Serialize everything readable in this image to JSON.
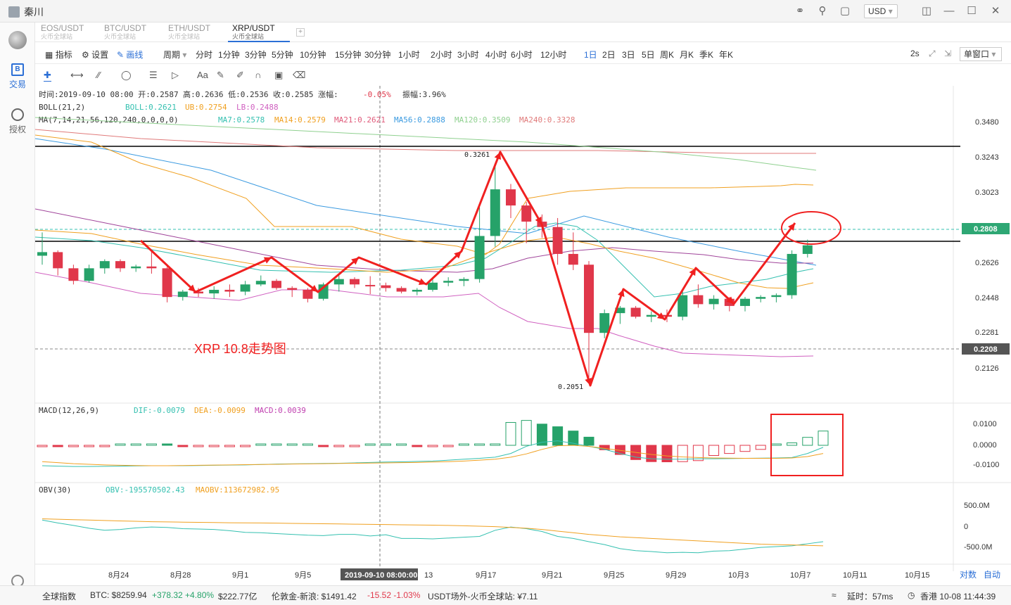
{
  "window": {
    "user": "秦川",
    "currency": "USD",
    "currency_arrow": "▾"
  },
  "sidebar": {
    "trade_label": "交易",
    "auth_label": "授权"
  },
  "tabs": [
    {
      "pair": "EOS/USDT",
      "exchange": "火币全球站"
    },
    {
      "pair": "BTC/USDT",
      "exchange": "火币全球站"
    },
    {
      "pair": "ETH/USDT",
      "exchange": "火币全球站"
    },
    {
      "pair": "XRP/USDT",
      "exchange": "火币全球站"
    }
  ],
  "toolbar": {
    "indicator": "指标",
    "settings": "设置",
    "draw": "画线",
    "period": "周期",
    "intervals": [
      "分时",
      "1分钟",
      "3分钟",
      "5分钟",
      "10分钟",
      "15分钟",
      "30分钟",
      "1小时",
      "2小时",
      "3小时",
      "4小时",
      "6小时",
      "12小时",
      "1日",
      "2日",
      "3日",
      "5日",
      "周K",
      "月K",
      "季K",
      "年K"
    ],
    "active_interval": "1日",
    "refresh": "2s",
    "window_mode": "单窗口"
  },
  "info": {
    "time_label": "时间:",
    "time": "2019-09-10 08:00",
    "open_label": "开:",
    "open": "0.2587",
    "high_label": "高:",
    "high": "0.2636",
    "low_label": "低:",
    "low": "0.2536",
    "close_label": "收:",
    "close": "0.2585",
    "change_label": "涨幅:",
    "change": "-0.05%",
    "amp_label": "振幅:",
    "amp": "3.96%"
  },
  "boll": {
    "name": "BOLL(21,2)",
    "mid": "BOLL:0.2621",
    "ub": "UB:0.2754",
    "lb": "LB:0.2488"
  },
  "ma": {
    "name": "MA(7,14,21,56,120,240,0,0,0,0)",
    "ma7": "MA7:0.2578",
    "ma14": "MA14:0.2579",
    "ma21": "MA21:0.2621",
    "ma56": "MA56:0.2888",
    "ma120": "MA120:0.3509",
    "ma240": "MA240:0.3328"
  },
  "macd": {
    "name": "MACD(12,26,9)",
    "dif": "DIF:-0.0079",
    "dea": "DEA:-0.0099",
    "macd": "MACD:0.0039"
  },
  "obv": {
    "name": "OBV(30)",
    "obv": "OBV:-195570502.43",
    "maobv": "MAOBV:113672982.95"
  },
  "annotation": "XRP 10.8走势图",
  "price_axis": [
    "0.3480",
    "0.3243",
    "0.3023",
    "0.2808",
    "0.2626",
    "0.2448",
    "0.2281",
    "0.2208",
    "0.2126"
  ],
  "macd_axis": [
    "0.0100",
    "0.0000",
    "-0.0100"
  ],
  "obv_axis": [
    "500.0M",
    "0",
    "-500.0M"
  ],
  "date_axis": [
    "8月24",
    "8月28",
    "9月1",
    "9月5",
    "13",
    "9月17",
    "9月21",
    "9月25",
    "9月29",
    "10月3",
    "10月7",
    "10月11",
    "10月15"
  ],
  "crosshair_date": "2019-09-10 08:00:00",
  "hi_label": "0.3261",
  "lo_label": "0.2051",
  "axis_buttons": {
    "log": "对数",
    "auto": "自动"
  },
  "status": {
    "index": "全球指数",
    "btc": "BTC: $8259.94",
    "btc_chg": "+378.32 +4.80%",
    "btc_cap": "$222.77亿",
    "gold": "伦敦金-新浪: $1491.42",
    "gold_chg": "-15.52 -1.03%",
    "usdt": "USDT场外-火币全球站: ¥7.11",
    "latency": "延时：57ms",
    "time": "香港 10-08 11:44:39"
  },
  "colors": {
    "up": "#26a269",
    "down": "#e0374a",
    "boll_mid": "#a0449a",
    "ub_lb": "#d060c0",
    "ma7": "#34c0b0",
    "ma14": "#f0a020",
    "accent": "#2b6fd6"
  },
  "chart_data": {
    "type": "candlestick",
    "price_range": [
      0.2051,
      0.3261
    ],
    "candles": [
      {
        "o": 0.275,
        "h": 0.288,
        "l": 0.27,
        "c": 0.277
      },
      {
        "o": 0.277,
        "h": 0.278,
        "l": 0.264,
        "c": 0.268
      },
      {
        "o": 0.268,
        "h": 0.27,
        "l": 0.259,
        "c": 0.261
      },
      {
        "o": 0.261,
        "h": 0.27,
        "l": 0.26,
        "c": 0.268
      },
      {
        "o": 0.268,
        "h": 0.273,
        "l": 0.265,
        "c": 0.272
      },
      {
        "o": 0.272,
        "h": 0.273,
        "l": 0.266,
        "c": 0.268
      },
      {
        "o": 0.268,
        "h": 0.27,
        "l": 0.266,
        "c": 0.269
      },
      {
        "o": 0.269,
        "h": 0.278,
        "l": 0.265,
        "c": 0.268
      },
      {
        "o": 0.268,
        "h": 0.269,
        "l": 0.249,
        "c": 0.252
      },
      {
        "o": 0.252,
        "h": 0.256,
        "l": 0.25,
        "c": 0.255
      },
      {
        "o": 0.255,
        "h": 0.257,
        "l": 0.252,
        "c": 0.254
      },
      {
        "o": 0.254,
        "h": 0.258,
        "l": 0.251,
        "c": 0.256
      },
      {
        "o": 0.256,
        "h": 0.259,
        "l": 0.252,
        "c": 0.255
      },
      {
        "o": 0.255,
        "h": 0.261,
        "l": 0.253,
        "c": 0.259
      },
      {
        "o": 0.259,
        "h": 0.264,
        "l": 0.258,
        "c": 0.261
      },
      {
        "o": 0.261,
        "h": 0.262,
        "l": 0.256,
        "c": 0.257
      },
      {
        "o": 0.257,
        "h": 0.258,
        "l": 0.252,
        "c": 0.256
      },
      {
        "o": 0.256,
        "h": 0.257,
        "l": 0.249,
        "c": 0.251
      },
      {
        "o": 0.251,
        "h": 0.26,
        "l": 0.25,
        "c": 0.259
      },
      {
        "o": 0.259,
        "h": 0.264,
        "l": 0.255,
        "c": 0.262
      },
      {
        "o": 0.262,
        "h": 0.263,
        "l": 0.257,
        "c": 0.259
      },
      {
        "o": 0.2587,
        "h": 0.2636,
        "l": 0.2536,
        "c": 0.2585
      },
      {
        "o": 0.2585,
        "h": 0.26,
        "l": 0.255,
        "c": 0.257
      },
      {
        "o": 0.257,
        "h": 0.258,
        "l": 0.254,
        "c": 0.255
      },
      {
        "o": 0.255,
        "h": 0.257,
        "l": 0.253,
        "c": 0.256
      },
      {
        "o": 0.256,
        "h": 0.262,
        "l": 0.255,
        "c": 0.26
      },
      {
        "o": 0.26,
        "h": 0.263,
        "l": 0.258,
        "c": 0.261
      },
      {
        "o": 0.261,
        "h": 0.263,
        "l": 0.258,
        "c": 0.262
      },
      {
        "o": 0.262,
        "h": 0.302,
        "l": 0.26,
        "c": 0.286
      },
      {
        "o": 0.286,
        "h": 0.3261,
        "l": 0.28,
        "c": 0.312
      },
      {
        "o": 0.312,
        "h": 0.315,
        "l": 0.296,
        "c": 0.303
      },
      {
        "o": 0.303,
        "h": 0.305,
        "l": 0.282,
        "c": 0.294
      },
      {
        "o": 0.294,
        "h": 0.298,
        "l": 0.285,
        "c": 0.291
      },
      {
        "o": 0.291,
        "h": 0.296,
        "l": 0.27,
        "c": 0.276
      },
      {
        "o": 0.276,
        "h": 0.288,
        "l": 0.267,
        "c": 0.27
      },
      {
        "o": 0.27,
        "h": 0.272,
        "l": 0.2051,
        "c": 0.232
      },
      {
        "o": 0.232,
        "h": 0.245,
        "l": 0.229,
        "c": 0.243
      },
      {
        "o": 0.243,
        "h": 0.247,
        "l": 0.237,
        "c": 0.246
      },
      {
        "o": 0.246,
        "h": 0.247,
        "l": 0.24,
        "c": 0.241
      },
      {
        "o": 0.241,
        "h": 0.244,
        "l": 0.238,
        "c": 0.242
      },
      {
        "o": 0.242,
        "h": 0.245,
        "l": 0.238,
        "c": 0.241
      },
      {
        "o": 0.241,
        "h": 0.256,
        "l": 0.239,
        "c": 0.253
      },
      {
        "o": 0.253,
        "h": 0.259,
        "l": 0.246,
        "c": 0.248
      },
      {
        "o": 0.248,
        "h": 0.253,
        "l": 0.245,
        "c": 0.251
      },
      {
        "o": 0.251,
        "h": 0.252,
        "l": 0.244,
        "c": 0.247
      },
      {
        "o": 0.247,
        "h": 0.252,
        "l": 0.244,
        "c": 0.251
      },
      {
        "o": 0.251,
        "h": 0.253,
        "l": 0.249,
        "c": 0.252
      },
      {
        "o": 0.252,
        "h": 0.254,
        "l": 0.249,
        "c": 0.253
      },
      {
        "o": 0.253,
        "h": 0.278,
        "l": 0.251,
        "c": 0.276
      },
      {
        "o": 0.276,
        "h": 0.284,
        "l": 0.274,
        "c": 0.2808
      }
    ],
    "macd_hist": [
      -0.0003,
      -0.0004,
      -0.0003,
      -0.0002,
      -0.0001,
      0.0001,
      0.0001,
      0.0001,
      0.0,
      -0.0002,
      -0.0002,
      -0.0002,
      -0.0002,
      -0.0001,
      0.0,
      0.0001,
      0.0001,
      0.0001,
      -0.0002,
      -0.0002,
      -0.0001,
      0.0002,
      0.0002,
      0.0002,
      -0.0004,
      -0.0004,
      -0.0004,
      0.0004,
      0.0004,
      0.0007,
      0.0112,
      0.0122,
      0.0104,
      0.0091,
      0.007,
      0.004,
      -0.0022,
      -0.0045,
      -0.007,
      -0.008,
      -0.0081,
      -0.008,
      -0.0075,
      -0.005,
      -0.004,
      -0.003,
      -0.002,
      0.0005,
      0.0012,
      0.0039,
      0.007
    ],
    "macd_dif": [
      -0.01,
      -0.0102,
      -0.0104,
      -0.0104,
      -0.0103,
      -0.0102,
      -0.0101,
      -0.01,
      -0.01,
      -0.01,
      -0.0099,
      -0.0098,
      -0.0097,
      -0.0096,
      -0.0094,
      -0.0092,
      -0.0091,
      -0.009,
      -0.0089,
      -0.0088,
      -0.0086,
      -0.0084,
      -0.0082,
      -0.0081,
      -0.0079,
      -0.0077,
      -0.0073,
      -0.0068,
      -0.0064,
      -0.0058,
      -0.004,
      -0.0005,
      0.0015,
      0.0022,
      0.001,
      -0.0005,
      -0.002,
      -0.004,
      -0.0058,
      -0.0066,
      -0.0068,
      -0.0068,
      -0.0066,
      -0.0066,
      -0.0065,
      -0.0064,
      -0.0063,
      -0.0062,
      -0.006,
      -0.004,
      -0.001
    ],
    "macd_dea": [
      -0.008,
      -0.0085,
      -0.009,
      -0.0093,
      -0.0096,
      -0.0098,
      -0.0099,
      -0.01,
      -0.01,
      -0.0099,
      -0.0098,
      -0.0097,
      -0.0096,
      -0.0095,
      -0.0094,
      -0.0093,
      -0.0092,
      -0.0091,
      -0.009,
      -0.0089,
      -0.0088,
      -0.0087,
      -0.0086,
      -0.0085,
      -0.0084,
      -0.0082,
      -0.008,
      -0.0077,
      -0.0073,
      -0.0068,
      -0.0058,
      -0.0042,
      -0.002,
      -0.0002,
      0.0,
      -0.0005,
      -0.0015,
      -0.0025,
      -0.0035,
      -0.0045,
      -0.0052,
      -0.0057,
      -0.006,
      -0.0062,
      -0.0063,
      -0.0064,
      -0.0064,
      -0.0064,
      -0.0062,
      -0.0055,
      -0.004
    ],
    "obv": [
      150,
      80,
      20,
      -50,
      -100,
      -80,
      -40,
      -20,
      -30,
      -60,
      -70,
      -80,
      -110,
      -150,
      -160,
      -180,
      -200,
      -220,
      -230,
      -200,
      -200,
      -240,
      -210,
      -300,
      -300,
      -310,
      -290,
      -270,
      -250,
      -100,
      -20,
      -60,
      -130,
      -250,
      -300,
      -380,
      -450,
      -550,
      -600,
      -620,
      -650,
      -640,
      -650,
      -610,
      -600,
      -560,
      -520,
      -500,
      -480,
      -430,
      -380
    ],
    "maobv": [
      180,
      170,
      160,
      150,
      140,
      130,
      120,
      110,
      105,
      100,
      95,
      90,
      85,
      82,
      80,
      75,
      70,
      65,
      60,
      55,
      50,
      45,
      40,
      35,
      30,
      25,
      20,
      10,
      0,
      -10,
      -30,
      -50,
      -80,
      -120,
      -160,
      -200,
      -230,
      -260,
      -280,
      -300,
      -320,
      -340,
      -360,
      -380,
      -400,
      -420,
      -440,
      -450,
      -460,
      -470,
      -480
    ]
  }
}
